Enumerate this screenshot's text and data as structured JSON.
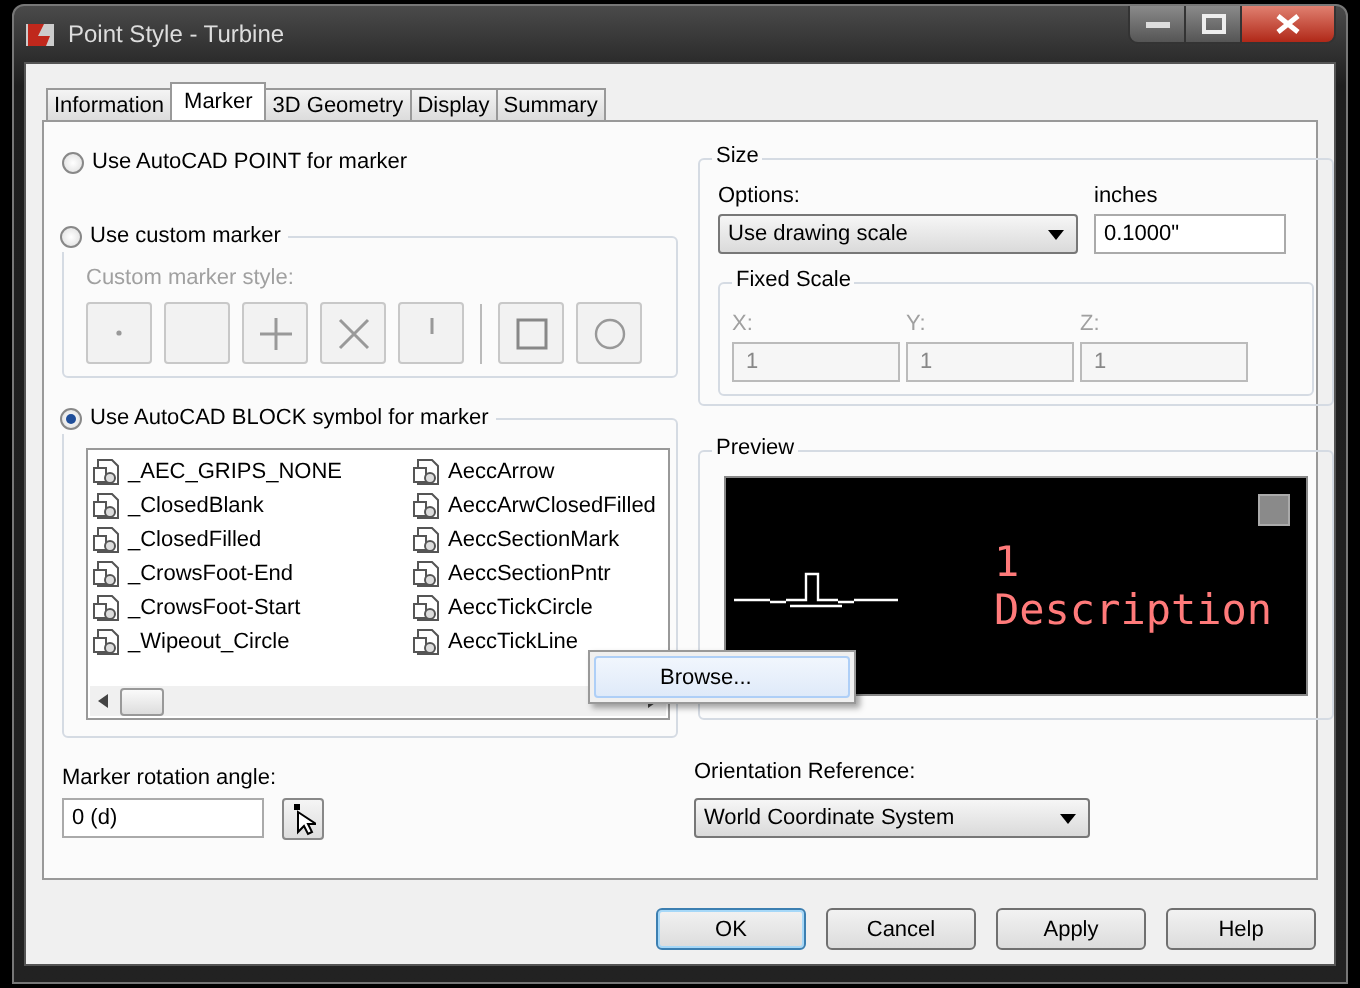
{
  "window": {
    "title": "Point Style - Turbine"
  },
  "tabs": [
    {
      "label": "Information",
      "selected": false
    },
    {
      "label": "Marker",
      "selected": true
    },
    {
      "label": "3D Geometry",
      "selected": false
    },
    {
      "label": "Display",
      "selected": false
    },
    {
      "label": "Summary",
      "selected": false
    }
  ],
  "marker_modes": [
    {
      "label": "Use AutoCAD POINT for marker",
      "selected": false
    },
    {
      "label": "Use custom marker",
      "selected": false
    },
    {
      "label": "Use AutoCAD BLOCK symbol for marker",
      "selected": true
    }
  ],
  "custom_marker": {
    "label": "Custom marker style:",
    "disabled": true,
    "styles": [
      {
        "kind": "dot"
      },
      {
        "kind": "blank"
      },
      {
        "kind": "plus"
      },
      {
        "kind": "cross"
      },
      {
        "kind": "tick"
      },
      {
        "kind": "square"
      },
      {
        "kind": "circle"
      }
    ]
  },
  "block_list": {
    "items": [
      {
        "name": "_AEC_GRIPS_NONE"
      },
      {
        "name": "_ClosedBlank"
      },
      {
        "name": "_ClosedFilled"
      },
      {
        "name": "_CrowsFoot-End"
      },
      {
        "name": "_CrowsFoot-Start"
      },
      {
        "name": "_Wipeout_Circle"
      },
      {
        "name": "AeccArrow"
      },
      {
        "name": "AeccArwClosedFilled"
      },
      {
        "name": "AeccSectionMark"
      },
      {
        "name": "AeccSectionPntr"
      },
      {
        "name": "AeccTickCircle"
      },
      {
        "name": "AeccTickLine"
      }
    ]
  },
  "context_menu": {
    "items": [
      "Browse..."
    ]
  },
  "size": {
    "title": "Size",
    "options_label": "Options:",
    "options_value": "Use drawing scale",
    "units_label": "inches",
    "units_value": "0.1000\"",
    "fixed_scale": {
      "title": "Fixed Scale",
      "disabled": true,
      "fields": [
        {
          "label": "X:",
          "value": "1"
        },
        {
          "label": "Y:",
          "value": "1"
        },
        {
          "label": "Z:",
          "value": "1"
        }
      ]
    }
  },
  "preview": {
    "title": "Preview",
    "label_lines": [
      "1",
      "Description"
    ]
  },
  "rotation": {
    "label": "Marker rotation angle:",
    "value": "0 (d)"
  },
  "orientation": {
    "label": "Orientation Reference:",
    "value": "World Coordinate System"
  },
  "buttons": [
    {
      "label": "OK",
      "default": true
    },
    {
      "label": "Cancel",
      "default": false
    },
    {
      "label": "Apply",
      "default": false
    },
    {
      "label": "Help",
      "default": false
    }
  ]
}
